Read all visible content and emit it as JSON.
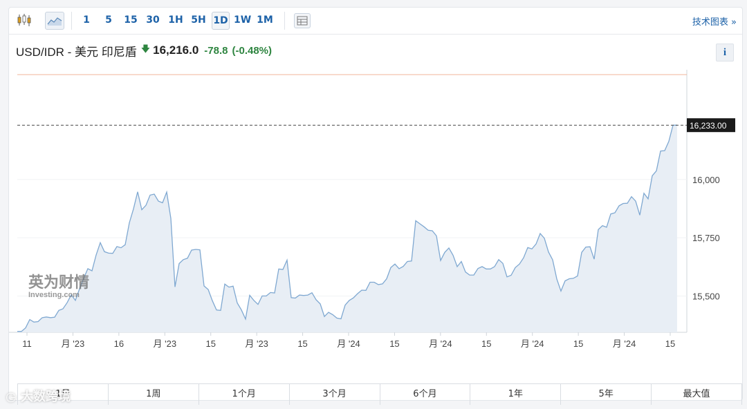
{
  "toolbar": {
    "chart_types": [
      "candlestick-icon",
      "area-chart-icon"
    ],
    "timeframes": [
      "1",
      "5",
      "15",
      "30",
      "1H",
      "5H",
      "1D",
      "1W",
      "1M"
    ],
    "active_timeframe": "1D",
    "technical_label": "技术图表 »"
  },
  "quote": {
    "pair": "USD/IDR - 美元 印尼盾",
    "last": "16,216.0",
    "change": "-78.8",
    "change_pct": "(-0.48%)",
    "direction": "down",
    "info_label": "i"
  },
  "ranges": [
    "1日",
    "1周",
    "1个月",
    "3个月",
    "6个月",
    "1年",
    "5年",
    "最大值"
  ],
  "watermark": {
    "logo_cn": "英为财情",
    "logo_en": "Investing.com",
    "footer": "大数跨境"
  },
  "colors": {
    "line": "#7fa8d1",
    "fill": "#e8eef5",
    "accent": "#1d62a8",
    "down": "#2e8540",
    "last_label_bg": "#1a1a1a"
  },
  "chart_data": {
    "type": "area",
    "ylim": [
      15350,
      16450
    ],
    "yticks": [
      15500,
      15750,
      16000
    ],
    "ytick_labels": [
      "15,500",
      "15,750",
      "16,000"
    ],
    "last_value_label": "16,233.00",
    "last_value": 16233,
    "xtick_labels": [
      "11",
      "月 '23",
      "16",
      "月 '23",
      "15",
      "月 '23",
      "15",
      "月 '24",
      "15",
      "月 '24",
      "15",
      "月 '24",
      "15",
      "月 '24",
      "15"
    ],
    "values": [
      15348,
      15348,
      15363,
      15399,
      15388,
      15390,
      15407,
      15410,
      15407,
      15409,
      15438,
      15445,
      15471,
      15505,
      15481,
      15531,
      15576,
      15617,
      15608,
      15676,
      15729,
      15690,
      15684,
      15683,
      15712,
      15707,
      15720,
      15814,
      15874,
      15947,
      15870,
      15889,
      15933,
      15937,
      15907,
      15900,
      15946,
      15833,
      15539,
      15639,
      15656,
      15662,
      15697,
      15700,
      15698,
      15543,
      15528,
      15480,
      15440,
      15438,
      15551,
      15538,
      15542,
      15470,
      15440,
      15401,
      15503,
      15481,
      15464,
      15500,
      15500,
      15515,
      15513,
      15616,
      15614,
      15654,
      15493,
      15491,
      15504,
      15502,
      15504,
      15514,
      15484,
      15466,
      15412,
      15430,
      15420,
      15405,
      15402,
      15461,
      15481,
      15492,
      15510,
      15525,
      15524,
      15559,
      15559,
      15549,
      15552,
      15574,
      15622,
      15637,
      15617,
      15627,
      15648,
      15650,
      15823,
      15810,
      15797,
      15782,
      15780,
      15758,
      15652,
      15687,
      15706,
      15675,
      15626,
      15648,
      15603,
      15590,
      15590,
      15618,
      15626,
      15616,
      15616,
      15626,
      15656,
      15640,
      15582,
      15589,
      15622,
      15637,
      15664,
      15708,
      15702,
      15723,
      15768,
      15748,
      15689,
      15655,
      15573,
      15521,
      15565,
      15574,
      15576,
      15586,
      15687,
      15710,
      15711,
      15658,
      15785,
      15802,
      15795,
      15852,
      15857,
      15887,
      15897,
      15898,
      15926,
      15907,
      15847,
      15941,
      15917,
      16016,
      16037,
      16122,
      16124,
      16164,
      16233,
      16233
    ]
  }
}
